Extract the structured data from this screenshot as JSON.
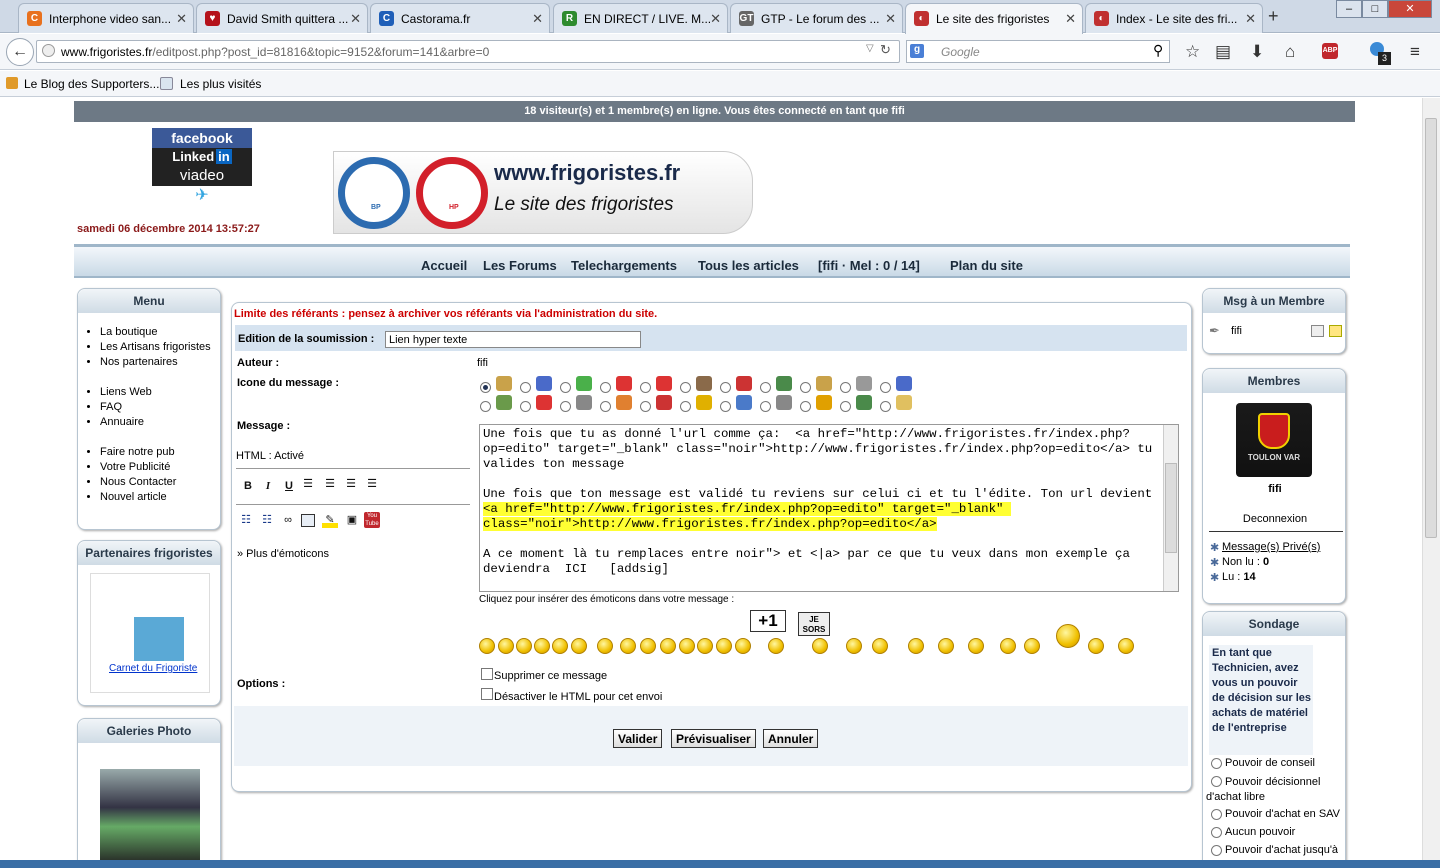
{
  "browser": {
    "tabs": [
      {
        "label": "Interphone video san...",
        "icon_color": "#e8711e",
        "icon": "C",
        "active": false
      },
      {
        "label": "David Smith quittera ...",
        "icon_color": "#b5121b",
        "icon": "♥",
        "active": false
      },
      {
        "label": "Castorama.fr",
        "icon_color": "#1f5fb8",
        "icon": "C",
        "active": false
      },
      {
        "label": "EN DIRECT / LIVE. M...",
        "icon_color": "#2e8b2e",
        "icon": "R",
        "active": false
      },
      {
        "label": "GTP - Le forum des ...",
        "icon_color": "#666666",
        "icon": "GT",
        "active": false
      },
      {
        "label": "Le site des frigoristes",
        "icon_color": "#c03030",
        "icon": "◐",
        "active": true
      },
      {
        "label": "Index - Le site des fri...",
        "icon_color": "#c03030",
        "icon": "◐",
        "active": false
      }
    ],
    "url_host": "www.frigoristes.fr",
    "url_path": "/editpost.php?post_id=81816&topic=9152&forum=141&arbre=0",
    "search_placeholder": "Google",
    "bookmarks": [
      "Le Blog des Supporters...",
      "Les plus visités"
    ],
    "badge_count": "3"
  },
  "site": {
    "online_text": "18 visiteur(s) et 1 membre(s) en ligne. Vous êtes connecté en tant que fifi",
    "social": [
      "facebook",
      "Linked",
      "in",
      "viadeo"
    ],
    "date": "samedi 06 décembre 2014 13:57:27",
    "logo_title": "www.frigoristes.fr",
    "logo_subtitle": "Le site des frigoristes",
    "gauge_left": "BP",
    "gauge_right": "HP",
    "nav": [
      "Accueil",
      "Les Forums",
      "Telechargements",
      "Tous les articles",
      "[fifi · Mel : 0 / 14]",
      "Plan du site"
    ]
  },
  "left": {
    "menu_title": "Menu",
    "menu_groups": [
      [
        "La boutique",
        "Les Artisans frigoristes",
        "Nos partenaires"
      ],
      [
        "Liens Web",
        "FAQ",
        "Annuaire"
      ],
      [
        "Faire notre pub",
        "Votre Publicité",
        "Nous Contacter",
        "Nouvel article"
      ]
    ],
    "partners_title": "Partenaires frigoristes",
    "partner_link": "Carnet du Frigoriste",
    "gallery_title": "Galeries Photo"
  },
  "form": {
    "warning": "Limite des référants : pensez à archiver vos référants via l'administration du site.",
    "subject_label": "Edition de la soumission :",
    "subject_value": "Lien hyper texte",
    "author_label": "Auteur :",
    "author_value": "fifi",
    "icon_label": "Icone du message :",
    "message_label": "Message :",
    "html_status": "HTML : Activé",
    "more_emoticons": "» Plus d'émoticons",
    "message_p1": "Une fois que tu as donné l'url comme ça:  <a href=\"http://www.frigoristes.fr/index.php?op=edito\" target=\"_blank\" class=\"noir\">http://www.frigoristes.fr/index.php?op=edito</a> tu valides ton message",
    "message_p2a": "Une fois que ton message est validé tu reviens sur celui ci et tu l'édite. Ton url devient   ",
    "message_p2b": "<a href=\"http://www.frigoristes.fr/index.php?op=edito\" target=\"_blank\" class=\"noir\">http://www.frigoristes.fr/index.php?op=edito</a>",
    "message_p3": "A ce moment là tu remplaces entre noir\"> et <|a> par ce que tu veux dans mon exemple ça deviendra  ICI   [addsig]",
    "emoticon_hint": "Cliquez pour insérer des émoticons dans votre message :",
    "sign_plus": "+1",
    "sign_sors": "JE SORS",
    "options_label": "Options :",
    "opt1": "Supprimer ce message",
    "opt2": "Désactiver le HTML pour cet envoi",
    "btn_validate": "Valider",
    "btn_preview": "Prévisualiser",
    "btn_cancel": "Annuler"
  },
  "right": {
    "msg_title": "Msg à un Membre",
    "msg_user": "fifi",
    "members_title": "Membres",
    "avatar_text": "TOULON VAR",
    "member_name": "fifi",
    "logout": "Deconnexion",
    "pm_link": "Message(s) Privé(s)",
    "unread_label": "Non lu :",
    "unread": "0",
    "read_label": "Lu :",
    "read": "14",
    "poll_title": "Sondage",
    "poll_question": "En tant que Technicien, avez vous un pouvoir de décision sur les achats de matériel de l'entreprise",
    "poll_options": [
      "Pouvoir de conseil",
      "Pouvoir décisionnel d'achat libre",
      "Pouvoir d'achat en SAV",
      "Aucun pouvoir",
      "Pouvoir d'achat jusqu'à"
    ]
  }
}
